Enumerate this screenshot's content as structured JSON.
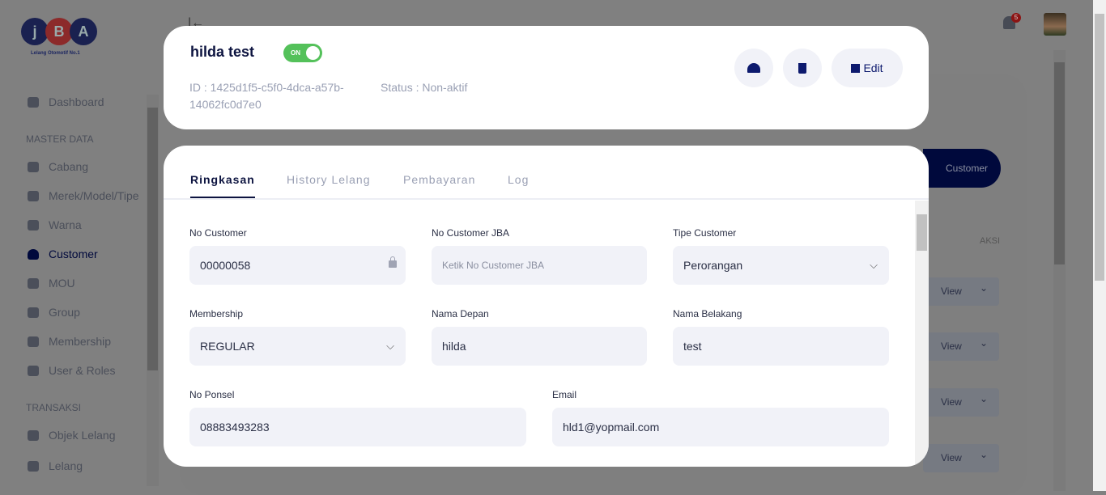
{
  "brand": {
    "letters": [
      "j",
      "B",
      "A"
    ],
    "tagline": "Lelang Otomotif No.1"
  },
  "sidebar": {
    "items": [
      {
        "label": "Dashboard",
        "icon": "dashboard-icon"
      },
      {
        "section": "MASTER DATA"
      },
      {
        "label": "Cabang",
        "icon": "map-pin-icon"
      },
      {
        "label": "Merek/Model/Tipe",
        "icon": "car-icon"
      },
      {
        "label": "Warna",
        "icon": "palette-icon"
      },
      {
        "label": "Customer",
        "icon": "user-icon",
        "active": true
      },
      {
        "label": "MOU",
        "icon": "briefcase-icon"
      },
      {
        "label": "Group",
        "icon": "users-icon"
      },
      {
        "label": "Membership",
        "icon": "car-icon"
      },
      {
        "label": "User & Roles",
        "icon": "user-cog-icon"
      },
      {
        "section": "TRANSAKSI"
      },
      {
        "label": "Objek Lelang",
        "icon": "car-icon"
      },
      {
        "label": "Lelang",
        "icon": "gavel-icon"
      }
    ]
  },
  "header": {
    "notification_count": "5"
  },
  "background": {
    "add_customer": "Customer",
    "aksi": "AKSI",
    "view": "View"
  },
  "modal": {
    "name": "hilda test",
    "toggle": "ON",
    "id_text": "ID : 1425d1f5-c5f0-4dca-a57b-14062fc0d7e0",
    "status_text": "Status : Non-aktif",
    "edit_label": "Edit",
    "tabs": [
      "Ringkasan",
      "History Lelang",
      "Pembayaran",
      "Log"
    ],
    "fields": {
      "no_customer": {
        "label": "No Customer",
        "value": "00000058"
      },
      "no_customer_jba": {
        "label": "No Customer JBA",
        "placeholder": "Ketik No Customer JBA"
      },
      "tipe_customer": {
        "label": "Tipe Customer",
        "value": "Perorangan"
      },
      "membership": {
        "label": "Membership",
        "value": "REGULAR"
      },
      "nama_depan": {
        "label": "Nama Depan",
        "value": "hilda"
      },
      "nama_belakang": {
        "label": "Nama Belakang",
        "value": "test"
      },
      "no_ponsel": {
        "label": "No Ponsel",
        "value": "08883493283"
      },
      "email": {
        "label": "Email",
        "value": "hld1@yopmail.com"
      }
    }
  },
  "colors": {
    "primary": "#0d1440",
    "toggle_on": "#54c15a",
    "field_bg": "#f1f2f8"
  }
}
